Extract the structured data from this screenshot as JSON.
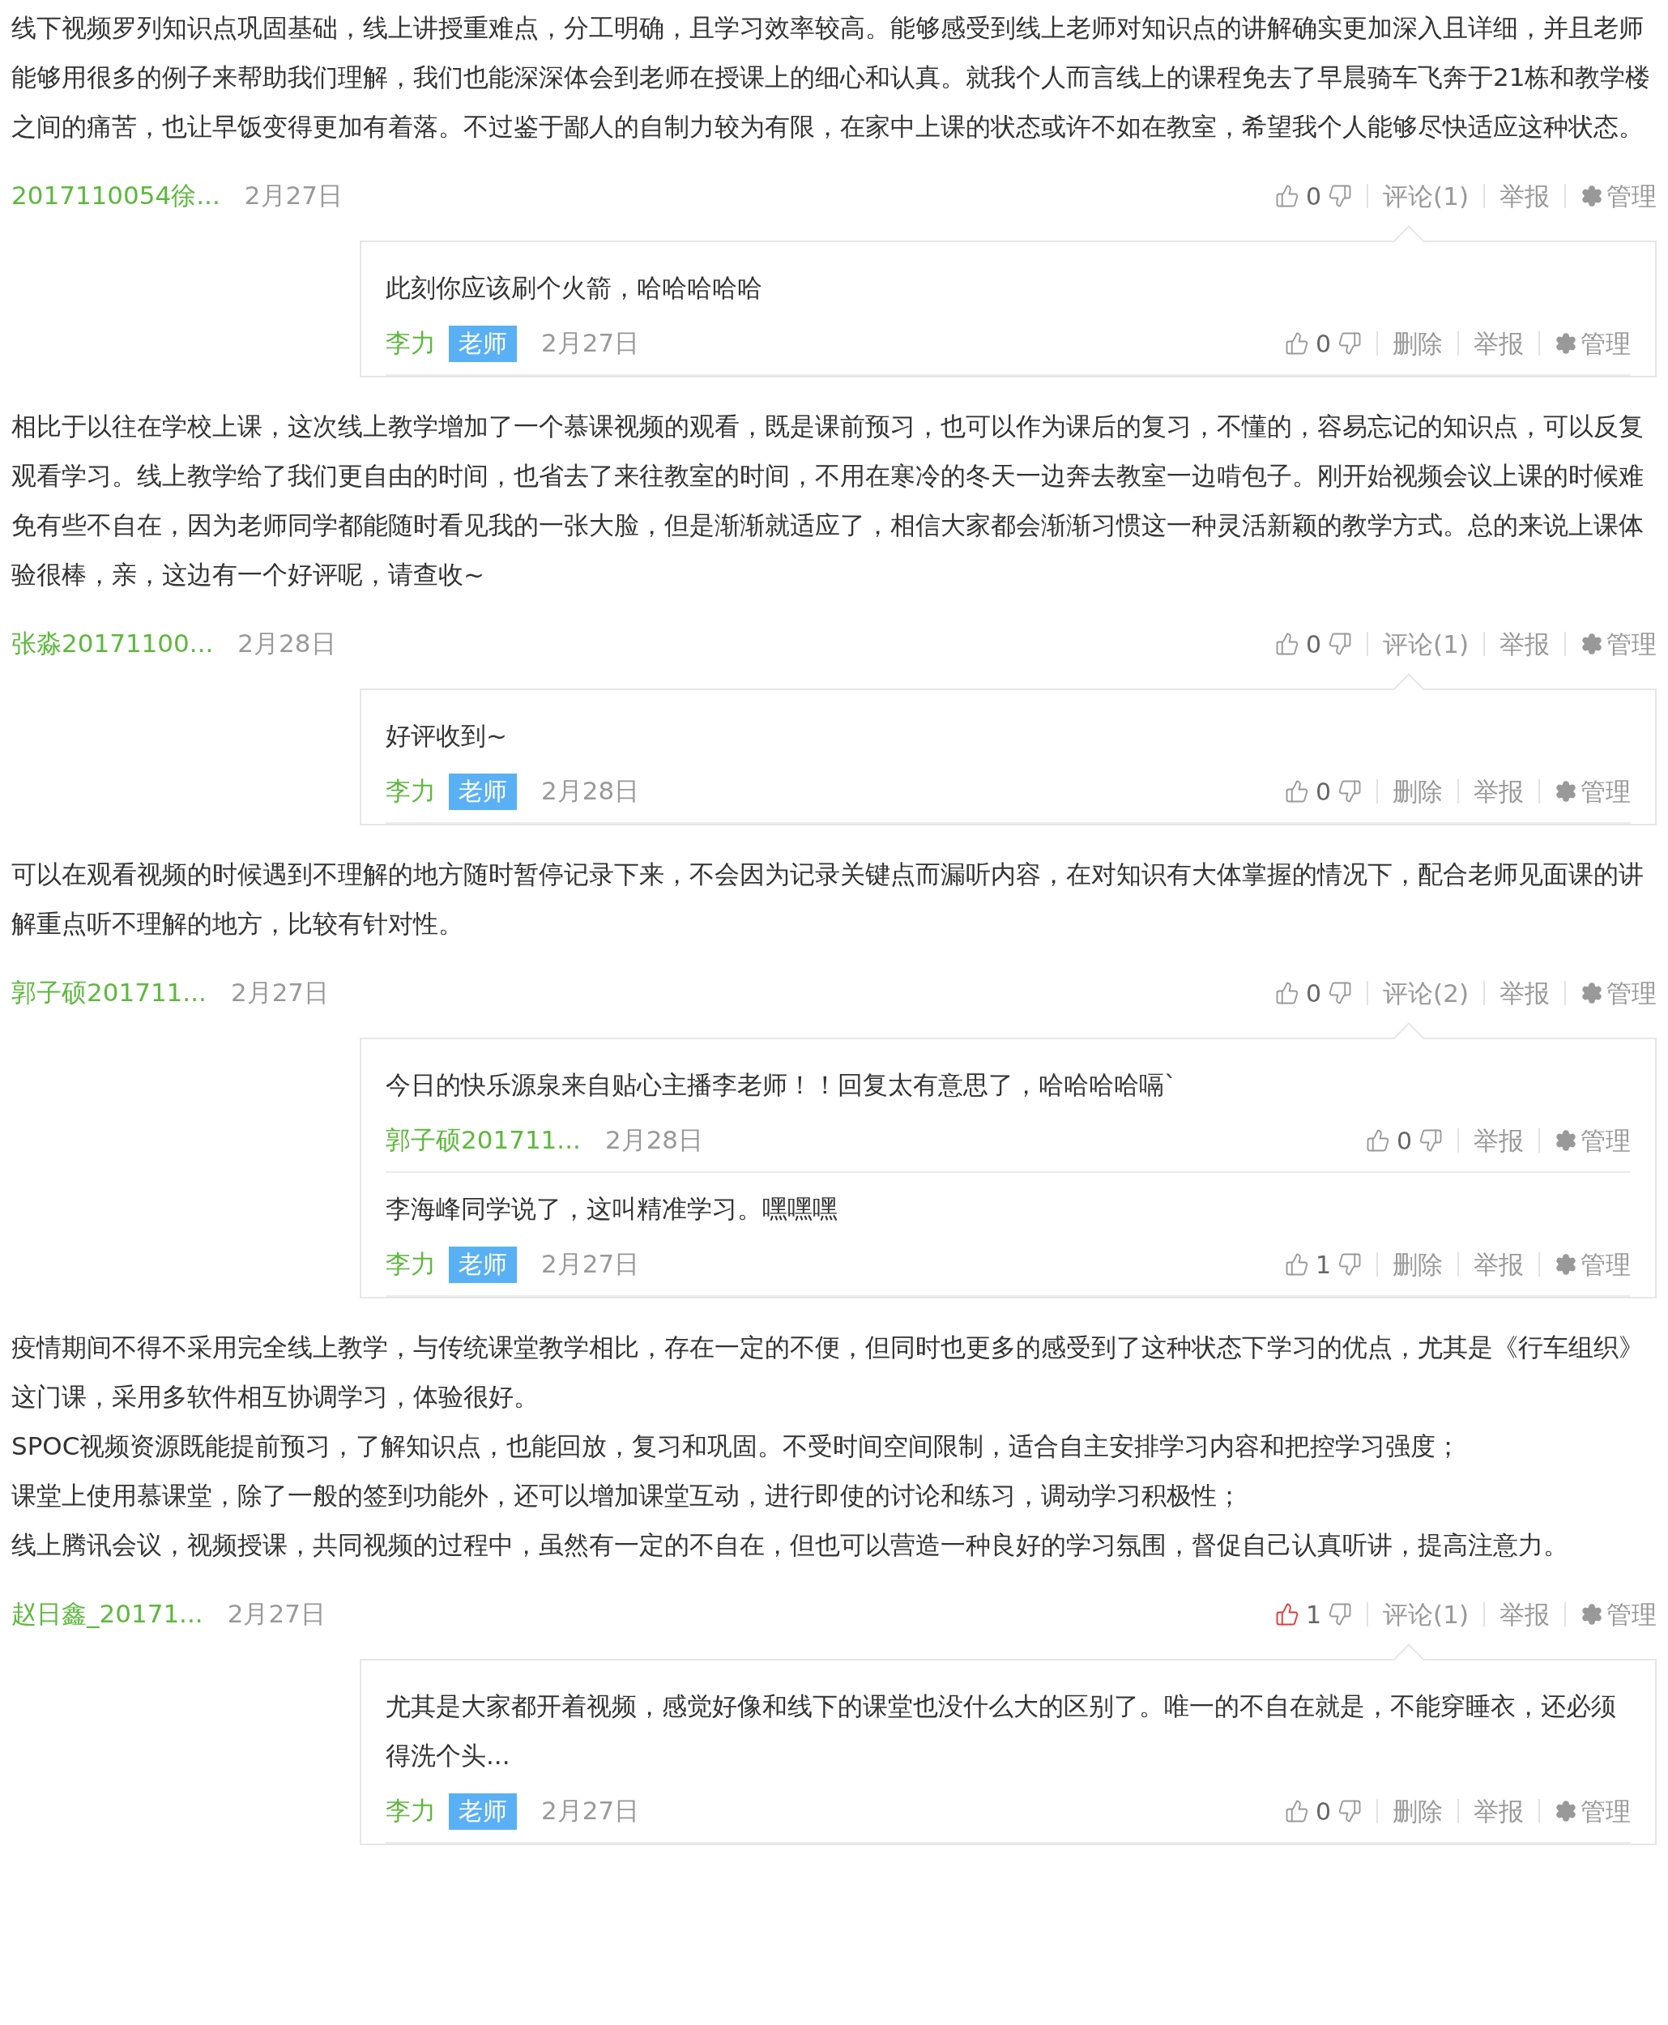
{
  "posts": [
    {
      "paragraphs": [
        "线下视频罗列知识点巩固基础，线上讲授重难点，分工明确，且学习效率较高。能够感受到线上老师对知识点的讲解确实更加深入且详细，并且老师能够用很多的例子来帮助我们理解，我们也能深深体会到老师在授课上的细心和认真。就我个人而言线上的课程免去了早晨骑车飞奔于21栋和教学楼之间的痛苦，也让早饭变得更加有着落。不过鉴于鄙人的自制力较为有限，在家中上课的状态或许不如在教室，希望我个人能够尽快适应这种状态。"
      ],
      "author": "2017110054徐...",
      "date": "2月27日",
      "likes": "0",
      "liked": false,
      "actions": [
        {
          "label": "评论(1)",
          "kind": "text"
        },
        {
          "label": "举报",
          "kind": "text"
        },
        {
          "label": "管理",
          "kind": "gear"
        }
      ],
      "replies": [
        {
          "text": "此刻你应该刷个火箭，哈哈哈哈哈",
          "author": "李力",
          "badge": "老师",
          "date": "2月27日",
          "likes": "0",
          "liked": false,
          "actions": [
            {
              "label": "删除",
              "kind": "text"
            },
            {
              "label": "举报",
              "kind": "text"
            },
            {
              "label": "管理",
              "kind": "gear"
            }
          ]
        }
      ]
    },
    {
      "paragraphs": [
        "相比于以往在学校上课，这次线上教学增加了一个慕课视频的观看，既是课前预习，也可以作为课后的复习，不懂的，容易忘记的知识点，可以反复观看学习。线上教学给了我们更自由的时间，也省去了来往教室的时间，不用在寒冷的冬天一边奔去教室一边啃包子。刚开始视频会议上课的时候难免有些不自在，因为老师同学都能随时看见我的一张大脸，但是渐渐就适应了，相信大家都会渐渐习惯这一种灵活新颖的教学方式。总的来说上课体验很棒，亲，这边有一个好评呢，请查收~"
      ],
      "author": "张淼20171100...",
      "date": "2月28日",
      "likes": "0",
      "liked": false,
      "actions": [
        {
          "label": "评论(1)",
          "kind": "text"
        },
        {
          "label": "举报",
          "kind": "text"
        },
        {
          "label": "管理",
          "kind": "gear"
        }
      ],
      "replies": [
        {
          "text": "好评收到~",
          "author": "李力",
          "badge": "老师",
          "date": "2月28日",
          "likes": "0",
          "liked": false,
          "actions": [
            {
              "label": "删除",
              "kind": "text"
            },
            {
              "label": "举报",
              "kind": "text"
            },
            {
              "label": "管理",
              "kind": "gear"
            }
          ]
        }
      ]
    },
    {
      "paragraphs": [
        "可以在观看视频的时候遇到不理解的地方随时暂停记录下来，不会因为记录关键点而漏听内容，在对知识有大体掌握的情况下，配合老师见面课的讲解重点听不理解的地方，比较有针对性。"
      ],
      "author": "郭子硕201711...",
      "date": "2月27日",
      "likes": "0",
      "liked": false,
      "actions": [
        {
          "label": "评论(2)",
          "kind": "text"
        },
        {
          "label": "举报",
          "kind": "text"
        },
        {
          "label": "管理",
          "kind": "gear"
        }
      ],
      "replies": [
        {
          "text": "今日的快乐源泉来自贴心主播李老师！！回复太有意思了，哈哈哈哈嗝`",
          "author": "郭子硕201711...",
          "date": "2月28日",
          "likes": "0",
          "liked": false,
          "actions": [
            {
              "label": "举报",
              "kind": "text"
            },
            {
              "label": "管理",
              "kind": "gear"
            }
          ]
        },
        {
          "text": "李海峰同学说了，这叫精准学习。嘿嘿嘿",
          "author": "李力",
          "badge": "老师",
          "date": "2月27日",
          "likes": "1",
          "liked": false,
          "actions": [
            {
              "label": "删除",
              "kind": "text"
            },
            {
              "label": "举报",
              "kind": "text"
            },
            {
              "label": "管理",
              "kind": "gear"
            }
          ]
        }
      ]
    },
    {
      "paragraphs": [
        "疫情期间不得不采用完全线上教学，与传统课堂教学相比，存在一定的不便，但同时也更多的感受到了这种状态下学习的优点，尤其是《行车组织》这门课，采用多软件相互协调学习，体验很好。",
        "SPOC视频资源既能提前预习，了解知识点，也能回放，复习和巩固。不受时间空间限制，适合自主安排学习内容和把控学习强度；",
        "课堂上使用慕课堂，除了一般的签到功能外，还可以增加课堂互动，进行即使的讨论和练习，调动学习积极性；",
        "线上腾讯会议，视频授课，共同视频的过程中，虽然有一定的不自在，但也可以营造一种良好的学习氛围，督促自己认真听讲，提高注意力。"
      ],
      "author": "赵日鑫_20171...",
      "date": "2月27日",
      "likes": "1",
      "liked": true,
      "actions": [
        {
          "label": "评论(1)",
          "kind": "text"
        },
        {
          "label": "举报",
          "kind": "text"
        },
        {
          "label": "管理",
          "kind": "gear"
        }
      ],
      "replies": [
        {
          "text": "尤其是大家都开着视频，感觉好像和线下的课堂也没什么大的区别了。唯一的不自在就是，不能穿睡衣，还必须得洗个头...",
          "author": "李力",
          "badge": "老师",
          "date": "2月27日",
          "likes": "0",
          "liked": false,
          "actions": [
            {
              "label": "删除",
              "kind": "text"
            },
            {
              "label": "举报",
              "kind": "text"
            },
            {
              "label": "管理",
              "kind": "gear"
            }
          ]
        }
      ]
    }
  ]
}
